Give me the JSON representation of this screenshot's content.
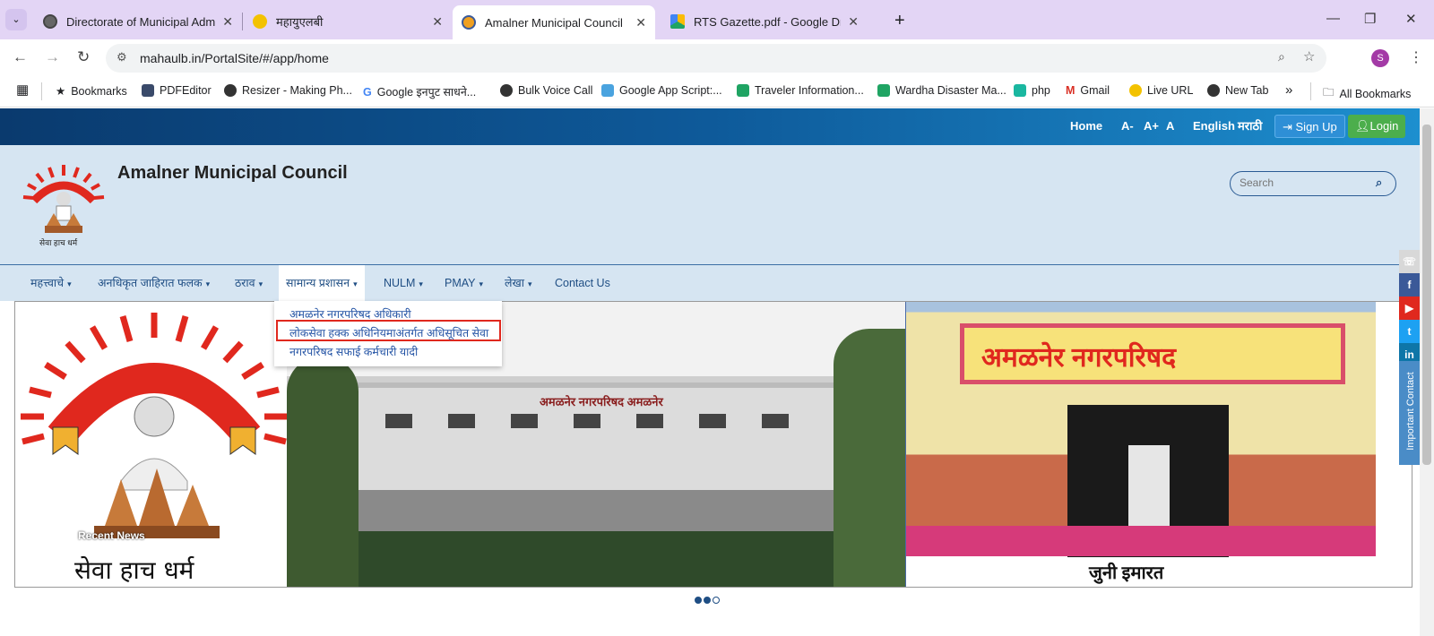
{
  "browser": {
    "tabs": [
      {
        "title": "Directorate of Municipal Admin",
        "active": false,
        "favicon_color": "#555555"
      },
      {
        "title": "महायुएलबी",
        "active": false,
        "favicon_color": "#e8a800"
      },
      {
        "title": "Amalner Municipal Council",
        "active": true,
        "favicon_color": "#f0a020"
      },
      {
        "title": "RTS Gazette.pdf - Google Drive",
        "active": false,
        "favicon_color": "#1fa463"
      }
    ],
    "new_tab_label": "+",
    "url": "mahaulb.in/PortalSite/#/app/home",
    "profile_initial": "S",
    "bookmarks": [
      {
        "label": "Bookmarks",
        "icon": "star-icon"
      },
      {
        "label": "PDFEditor",
        "icon": "pdf-icon"
      },
      {
        "label": "Resizer - Making Ph...",
        "icon": "globe-icon"
      },
      {
        "label": "Google इनपुट साधने...",
        "icon": "google-icon"
      },
      {
        "label": "Bulk Voice Call",
        "icon": "globe-icon"
      },
      {
        "label": "Google App Script:...",
        "icon": "w-icon"
      },
      {
        "label": "Traveler Information...",
        "icon": "sheets-icon"
      },
      {
        "label": "Wardha Disaster Ma...",
        "icon": "sheets-icon"
      },
      {
        "label": "php",
        "icon": "hex-icon"
      },
      {
        "label": "Gmail",
        "icon": "gmail-icon"
      },
      {
        "label": "Live URL",
        "icon": "coin-icon"
      },
      {
        "label": "New Tab",
        "icon": "globe-icon"
      }
    ],
    "more_bookmarks": "»",
    "all_bookmarks": "All Bookmarks"
  },
  "site": {
    "topbar": {
      "home": "Home",
      "font_small": "A-",
      "font_large": "A+",
      "font_normal": "A",
      "english": "English",
      "marathi": "मराठी",
      "signup": "Sign Up",
      "login": "Login"
    },
    "title": "Amalner Municipal Council",
    "logo_caption": "सेवा हाच धर्म",
    "search_placeholder": "Search",
    "menu": [
      {
        "label": "महत्त्वाचे",
        "dropdown": true
      },
      {
        "label": "अनधिकृत जाहिरात फलक",
        "dropdown": true
      },
      {
        "label": "ठराव",
        "dropdown": true
      },
      {
        "label": "सामान्य प्रशासन",
        "dropdown": true,
        "active": true
      },
      {
        "label": "NULM",
        "dropdown": true
      },
      {
        "label": "PMAY",
        "dropdown": true
      },
      {
        "label": "लेखा",
        "dropdown": true
      },
      {
        "label": "Contact Us",
        "dropdown": false
      }
    ],
    "dropdown_items": [
      "अमळनेर नगरपरिषद अधिकारी",
      "लोकसेवा हक्क अधिनियमाअंतर्गत अधिसूचित सेवा",
      "नगरपरिषद सफाई कर्मचारी यादी"
    ],
    "slider": {
      "left_caption": "सेवा हाच धर्म",
      "recent_news": "Recent News",
      "building_sign": "अमळनेर नगरपरिषद अमळनेर",
      "right_sign": "अमळनेर नगरपरिषद",
      "right_caption": "जुनी इमारत",
      "dots_total": 3,
      "dots_active": 2
    },
    "side_panel": {
      "important_contact": "Important Contact",
      "social": [
        "phone",
        "facebook",
        "youtube",
        "twitter",
        "linkedin"
      ]
    }
  }
}
